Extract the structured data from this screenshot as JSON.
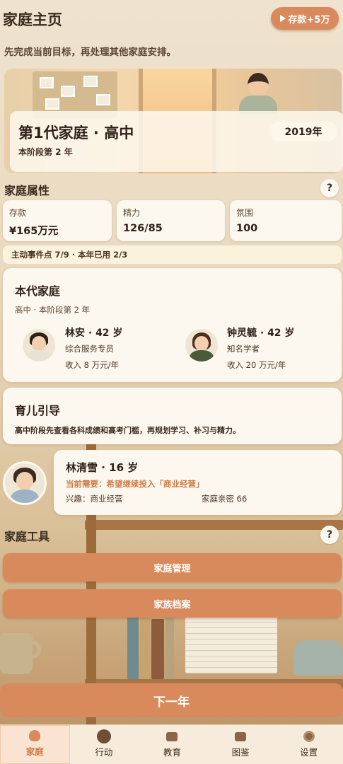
{
  "header": {
    "title": "家庭主页",
    "coin_button_label": "存款+5万",
    "subtitle": "先完成当前目标，再处理其他家庭安排。"
  },
  "hero": {
    "generation": "第1代家庭 · 高中",
    "stage": "本阶段第 2 年",
    "year": "2019年"
  },
  "attributes": {
    "title": "家庭属性",
    "help": "?",
    "stats": [
      {
        "label": "存款",
        "value": "¥165万元"
      },
      {
        "label": "精力",
        "value": "126/85"
      },
      {
        "label": "氛围",
        "value": "100"
      }
    ],
    "event_points": "主动事件点 7/9 · 本年已用 2/3"
  },
  "current_family": {
    "title": "本代家庭",
    "stage": "高中 · 本阶段第 2 年",
    "members": [
      {
        "name": "林安 · 42 岁",
        "job": "综合服务专员",
        "income": "收入 8 万元/年"
      },
      {
        "name": "钟灵毓 · 42 岁",
        "job": "知名学者",
        "income": "收入 20 万元/年"
      }
    ]
  },
  "guide": {
    "title": "育儿引导",
    "text": "高中阶段先查看各科成绩和高考门槛，再规划学习、补习与精力。"
  },
  "child": {
    "name": "林清雪 · 16 岁",
    "need": "当前需要：希望继续投入「商业经营」",
    "interest": "兴趣：商业经营",
    "intimacy": "家庭亲密 66"
  },
  "tools": {
    "title": "家庭工具",
    "help": "?",
    "buttons": [
      "家庭管理",
      "家族档案"
    ]
  },
  "next_year_label": "下一年",
  "nav": {
    "items": [
      {
        "label": "家庭",
        "icon": "home-icon",
        "active": true
      },
      {
        "label": "行动",
        "icon": "action-icon",
        "active": false
      },
      {
        "label": "教育",
        "icon": "education-icon",
        "active": false
      },
      {
        "label": "图鉴",
        "icon": "collection-icon",
        "active": false
      },
      {
        "label": "设置",
        "icon": "settings-icon",
        "active": false
      }
    ]
  },
  "colors": {
    "accent": "#d98a5c",
    "card": "#fdf8ef",
    "need_text": "#d07a45"
  }
}
